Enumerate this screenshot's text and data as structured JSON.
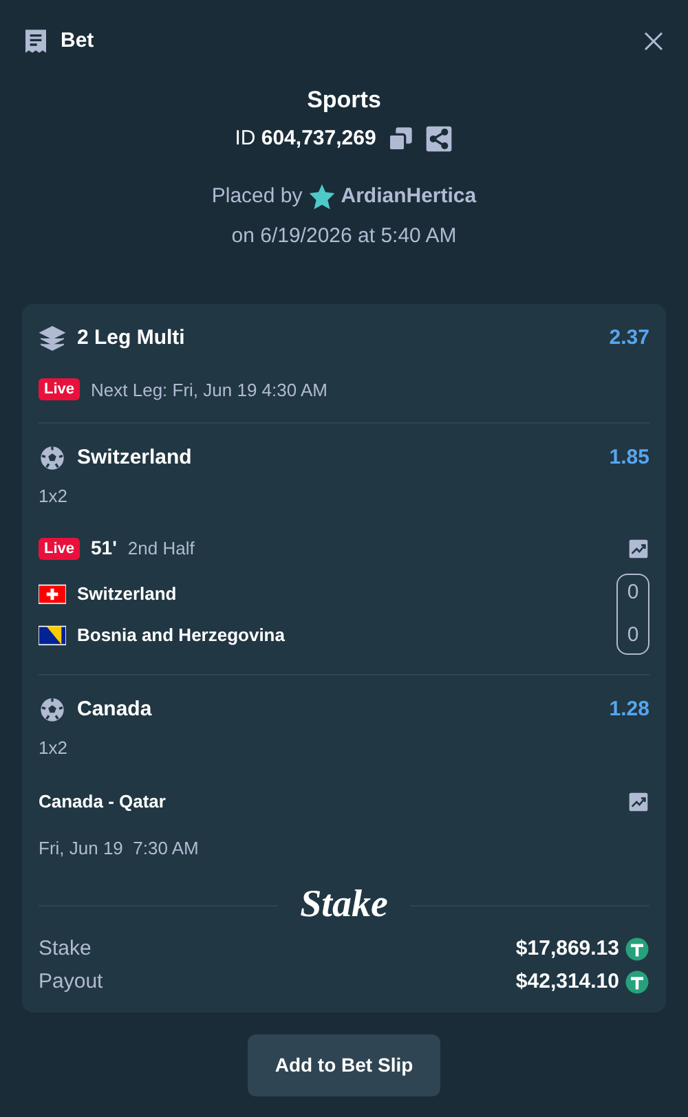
{
  "header": {
    "title": "Bet"
  },
  "summary": {
    "title": "Sports",
    "id_label": "ID",
    "id_value": "604,737,269",
    "placed_by_label": "Placed by",
    "user": "ArdianHertica",
    "placed_on": "on 6/19/2026 at 5:40 AM"
  },
  "multi": {
    "title": "2 Leg Multi",
    "odds": "2.37",
    "live_badge": "Live",
    "next_leg": "Next Leg: Fri, Jun 19 4:30 AM"
  },
  "legs": [
    {
      "kind": "live",
      "selection": "Switzerland",
      "odds": "1.85",
      "market": "1x2",
      "live_badge": "Live",
      "minute": "51'",
      "period": "2nd Half",
      "teams": [
        {
          "name": "Switzerland",
          "kind": "swiss_flag",
          "score": "0"
        },
        {
          "name": "Bosnia and Herzegovina",
          "kind": "bosnian_flag",
          "score": "0"
        }
      ]
    },
    {
      "kind": "upcoming",
      "selection": "Canada",
      "odds": "1.28",
      "market": "1x2",
      "match": "Canada - Qatar",
      "date": "Fri, Jun 19",
      "time": "7:30 AM"
    }
  ],
  "brand": "Stake",
  "totals": [
    {
      "label": "Stake",
      "amount": "$17,869.13"
    },
    {
      "label": "Payout",
      "amount": "$42,314.10"
    }
  ],
  "button": "Add to Bet Slip"
}
